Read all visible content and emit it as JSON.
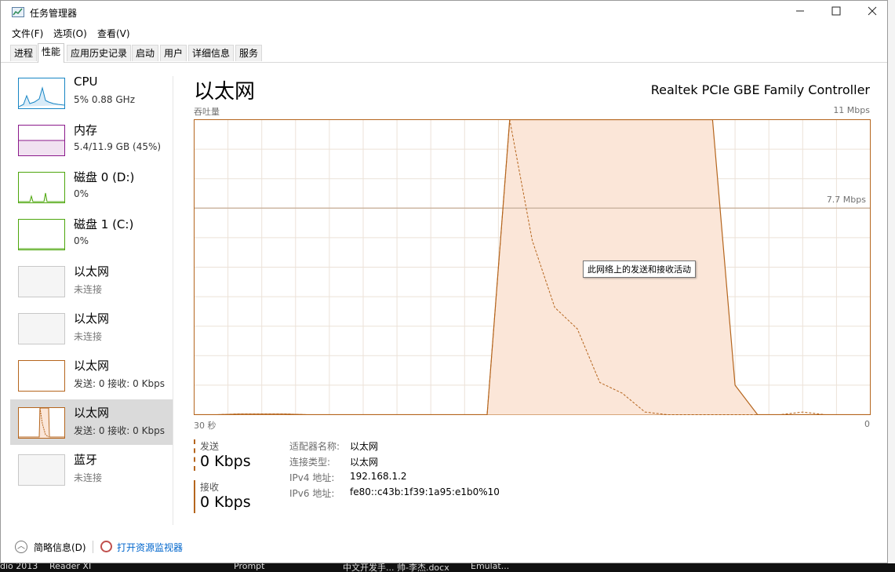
{
  "window": {
    "title": "任务管理器"
  },
  "menu": [
    "文件(F)",
    "选项(O)",
    "查看(V)"
  ],
  "tabs": [
    "进程",
    "性能",
    "应用历史记录",
    "启动",
    "用户",
    "详细信息",
    "服务"
  ],
  "sidebar": [
    {
      "name": "CPU",
      "value": "5% 0.88 GHz"
    },
    {
      "name": "内存",
      "value": "5.4/11.9 GB (45%)"
    },
    {
      "name": "磁盘 0 (D:)",
      "value": "0%"
    },
    {
      "name": "磁盘 1 (C:)",
      "value": "0%"
    },
    {
      "name": "以太网",
      "value": "未连接"
    },
    {
      "name": "以太网",
      "value": "未连接"
    },
    {
      "name": "以太网",
      "value": "发送: 0  接收: 0 Kbps"
    },
    {
      "name": "以太网",
      "value": "发送: 0  接收: 0 Kbps"
    },
    {
      "name": "蓝牙",
      "value": "未连接"
    }
  ],
  "main": {
    "title": "以太网",
    "device": "Realtek PCIe GBE Family Controller",
    "chart_label": "吞吐量",
    "max_label": "11 Mbps",
    "mid_label": "7.7 Mbps",
    "time_label": "30 秒",
    "zero_label": "0",
    "tooltip": "此网络上的发送和接收活动"
  },
  "chart_data": {
    "type": "area",
    "y_unit": "Mbps",
    "ylim": [
      0,
      11
    ],
    "x_range_seconds": [
      30,
      0
    ],
    "reference_line": 7.7,
    "grid": true,
    "series": [
      {
        "values": [
          0,
          0,
          0.02,
          0.02,
          0.02,
          0,
          0,
          0,
          0,
          0,
          0,
          0,
          0,
          0,
          11,
          11,
          11,
          11,
          11,
          11,
          11,
          11,
          11,
          11,
          1.1,
          0,
          0,
          0,
          0,
          0,
          0
        ]
      },
      {
        "values": [
          0,
          0,
          0.03,
          0.03,
          0.03,
          0,
          0,
          0,
          0,
          0,
          0,
          0,
          0,
          0,
          11,
          6.5,
          4.0,
          3.2,
          1.2,
          0.8,
          0.1,
          0,
          0,
          0,
          0,
          0,
          0,
          0.1,
          0,
          0,
          0
        ]
      }
    ]
  },
  "stats": {
    "send_label": "发送",
    "send_value": "0 Kbps",
    "recv_label": "接收",
    "recv_value": "0 Kbps"
  },
  "props": [
    {
      "key": "适配器名称:",
      "value": "以太网"
    },
    {
      "key": "连接类型:",
      "value": "以太网"
    },
    {
      "key": "IPv4 地址:",
      "value": "192.168.1.2"
    },
    {
      "key": "IPv6 地址:",
      "value": "fe80::c43b:1f39:1a95:e1b0%10"
    }
  ],
  "footer": {
    "fewer": "简略信息(D)",
    "monitor": "打开资源监视器"
  },
  "taskbar": [
    "dio 2013",
    "Reader XI",
    "Prompt",
    "中文开发手... 帅-李杰.docx",
    "Emulat..."
  ],
  "colors": {
    "accent": "#b5651d",
    "fill": "#fbe6d8",
    "grid": "#ece2d8",
    "selected": "#dadada"
  }
}
